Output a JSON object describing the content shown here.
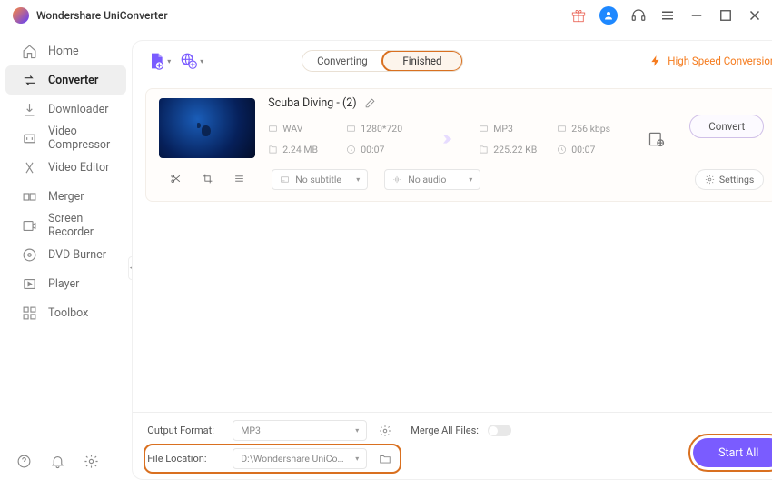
{
  "app": {
    "title": "Wondershare UniConverter"
  },
  "sidebar": {
    "items": [
      {
        "label": "Home"
      },
      {
        "label": "Converter"
      },
      {
        "label": "Downloader"
      },
      {
        "label": "Video Compressor"
      },
      {
        "label": "Video Editor"
      },
      {
        "label": "Merger"
      },
      {
        "label": "Screen Recorder"
      },
      {
        "label": "DVD Burner"
      },
      {
        "label": "Player"
      },
      {
        "label": "Toolbox"
      }
    ]
  },
  "tabs": {
    "converting": "Converting",
    "finished": "Finished"
  },
  "hsc": "High Speed Conversion",
  "item": {
    "title": "Scuba Diving - (2)",
    "src_format": "WAV",
    "src_res": "1280*720",
    "src_size": "2.24 MB",
    "src_dur": "00:07",
    "dst_format": "MP3",
    "dst_bitrate": "256 kbps",
    "dst_size": "225.22 KB",
    "dst_dur": "00:07",
    "convert": "Convert",
    "no_subtitle": "No subtitle",
    "no_audio": "No audio",
    "settings": "Settings"
  },
  "footer": {
    "output_format_label": "Output Format:",
    "output_format": "MP3",
    "merge_label": "Merge All Files:",
    "file_location_label": "File Location:",
    "file_location": "D:\\Wondershare UniConverter",
    "start_all": "Start All"
  }
}
